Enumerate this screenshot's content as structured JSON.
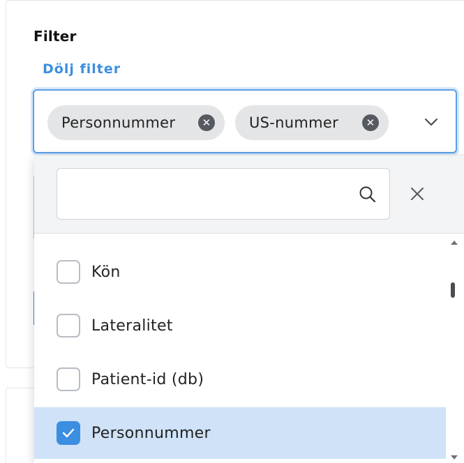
{
  "filter": {
    "title": "Filter",
    "toggle_link": "Dölj filter"
  },
  "multiselect": {
    "chips": [
      {
        "label": "Personnummer",
        "remove_icon": "close-circle-icon"
      },
      {
        "label": "US-nummer",
        "remove_icon": "close-circle-icon"
      }
    ],
    "expand_icon": "chevron-down-icon"
  },
  "dropdown": {
    "search": {
      "value": "",
      "placeholder": "",
      "icon": "search-icon"
    },
    "clear_icon": "close-icon",
    "options": [
      {
        "label": "Kön",
        "checked": false
      },
      {
        "label": "Lateralitet",
        "checked": false
      },
      {
        "label": "Patient-id (db)",
        "checked": false
      },
      {
        "label": "Personnummer",
        "checked": true
      }
    ]
  },
  "colors": {
    "accent": "#3b8ee0",
    "selected_row": "#cfe2f8",
    "chip_bg": "#e4e5e7"
  }
}
